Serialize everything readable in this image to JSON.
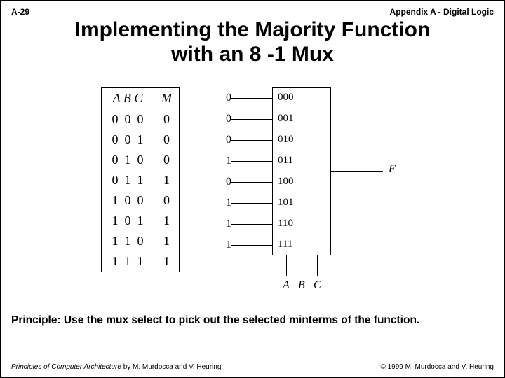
{
  "header": {
    "page_num": "A-29",
    "appendix": "Appendix A - Digital Logic"
  },
  "title_line1": "Implementing the Majority Function",
  "title_line2": "with an 8 -1 Mux",
  "truth_table": {
    "hdr_A": "A",
    "hdr_B": "B",
    "hdr_C": "C",
    "hdr_M": "M",
    "rows": [
      {
        "a": "0",
        "b": "0",
        "c": "0",
        "m": "0"
      },
      {
        "a": "0",
        "b": "0",
        "c": "1",
        "m": "0"
      },
      {
        "a": "0",
        "b": "1",
        "c": "0",
        "m": "0"
      },
      {
        "a": "0",
        "b": "1",
        "c": "1",
        "m": "1"
      },
      {
        "a": "1",
        "b": "0",
        "c": "0",
        "m": "0"
      },
      {
        "a": "1",
        "b": "0",
        "c": "1",
        "m": "1"
      },
      {
        "a": "1",
        "b": "1",
        "c": "0",
        "m": "1"
      },
      {
        "a": "1",
        "b": "1",
        "c": "1",
        "m": "1"
      }
    ]
  },
  "mux": {
    "inputs": [
      {
        "d": "0",
        "label": "000"
      },
      {
        "d": "0",
        "label": "001"
      },
      {
        "d": "0",
        "label": "010"
      },
      {
        "d": "1",
        "label": "011"
      },
      {
        "d": "0",
        "label": "100"
      },
      {
        "d": "1",
        "label": "101"
      },
      {
        "d": "1",
        "label": "110"
      },
      {
        "d": "1",
        "label": "111"
      }
    ],
    "output_label": "F",
    "select_A": "A",
    "select_B": "B",
    "select_C": "C"
  },
  "principle": "Principle: Use the mux select to pick out the selected minterms of the function.",
  "footer": {
    "book_title": "Principles of Computer Architecture",
    "authors": " by M. Murdocca and V. Heuring",
    "copyright": "© 1999 M. Murdocca and V. Heuring"
  }
}
